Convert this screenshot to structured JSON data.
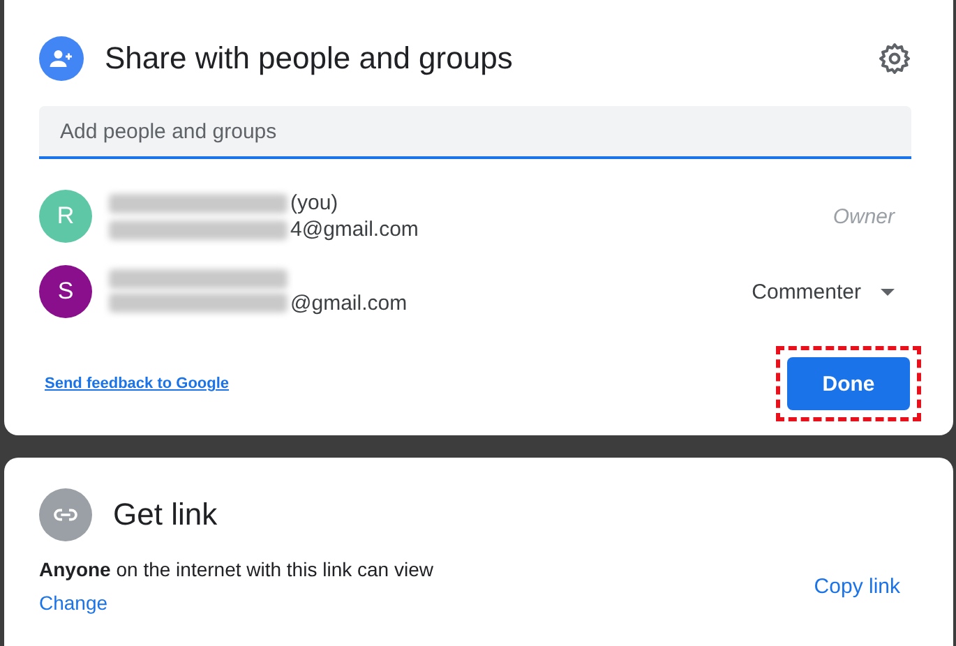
{
  "share": {
    "title": "Share with people and groups",
    "search": {
      "placeholder": "Add people and groups"
    },
    "people": [
      {
        "initial": "R",
        "color": "#5ec8a6",
        "name_suffix": "(you)",
        "email_suffix": "4@gmail.com",
        "role": "Owner",
        "kind": "fixed"
      },
      {
        "initial": "S",
        "color": "#890f8c",
        "email_suffix": "@gmail.com",
        "role": "Commenter",
        "kind": "dropdown"
      }
    ],
    "feedback_link": "Send feedback to Google",
    "done_button": "Done"
  },
  "link": {
    "title": "Get link",
    "description": "**Anyone** on the internet with this link can view",
    "change": "Change",
    "copy": "Copy link"
  }
}
